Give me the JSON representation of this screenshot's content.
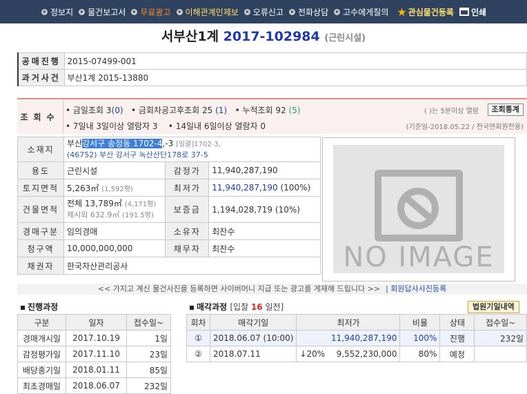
{
  "nav": {
    "items": [
      {
        "label": "정보지",
        "style": "normal"
      },
      {
        "label": "물건보고서",
        "style": "normal"
      },
      {
        "label": "무료광고",
        "style": "orange"
      },
      {
        "label": "이해관계인제보",
        "style": "yellow"
      },
      {
        "label": "오류신고",
        "style": "normal"
      },
      {
        "label": "전화상담",
        "style": "normal"
      },
      {
        "label": "고수에게질의",
        "style": "normal"
      }
    ],
    "favorite": "관심물건등록",
    "print": "인쇄"
  },
  "title": {
    "court": "서부산1계",
    "case_no": "2017-102984",
    "kind": "(근린시설)"
  },
  "public_sale": {
    "label": "공매진행",
    "value": "2015-07499-001"
  },
  "past_case": {
    "label": "과거사건",
    "value": "부산1계 2015-13880"
  },
  "views": {
    "label": "조회수",
    "today": "• 금일조회 3",
    "today_sub": "(0)",
    "after_notice": "• 금회차공고후조회 25",
    "after_notice_sub": "(1)",
    "total": "• 누적조회 92",
    "total_sub": "(5)",
    "week": "• 7일내 3일이상 열람자 3",
    "two_weeks": "• 14일내 6일이상 열람자 0",
    "note": "( )는 5분이상 열람",
    "button": "조회통계",
    "note2": "(기준일-2018.05.22 / 전국연회원전용)"
  },
  "details": {
    "location_label": "소재지",
    "location_pre": "부산",
    "location_sel": "강서구 송정동 1702-4",
    "location_post": ",-3",
    "location_bulk": "[일괄]1702-3,",
    "location_road": "(46752) 부산 강서구 녹산산단178로 37-5",
    "usage_label": "용도",
    "usage": "근린시설",
    "appraisal_label": "감정가",
    "appraisal": "11,940,287,190",
    "land_label": "토지면적",
    "land": "5,263㎡",
    "land_sub": "(1,592평)",
    "min_price_label": "최저가",
    "min_price": "11,940,287,190",
    "min_price_pct": "(100%)",
    "building_label": "건물면적",
    "building": "전체 13,789㎡",
    "building_sub": "(4,171평)",
    "building_excl": "제시외 632.9㎡",
    "building_excl_sub": "(191.5평)",
    "deposit_label": "보증금",
    "deposit": "1,194,028,719 (10%)",
    "auction_type_label": "경매구분",
    "auction_type": "임의경매",
    "owner_label": "소유자",
    "owner": "최찬수",
    "claim_label": "청구액",
    "claim": "10,000,000,000",
    "debtor_label": "채무자",
    "debtor": "최찬수",
    "creditor_label": "채권자",
    "creditor": "한국자산관리공사"
  },
  "image": {
    "placeholder": "NO IMAGE"
  },
  "notice": {
    "text": "<< 가지고 계신 물건사진을 등록하면 사이버머니 지급 또는 광고를 게재해 드립니다 >>",
    "link": "| 회원답사사진등록"
  },
  "progress": {
    "title": "진행과정",
    "headers": [
      "구분",
      "일자",
      "접수일~"
    ],
    "rows": [
      {
        "type": "경매개시일",
        "date": "2017.10.19",
        "days": "1일"
      },
      {
        "type": "감정평가일",
        "date": "2017.11.10",
        "days": "23일"
      },
      {
        "type": "배당종기일",
        "date": "2018.01.11",
        "days": "85일"
      },
      {
        "type": "최초경매일",
        "date": "2018.06.07",
        "days": "232일"
      }
    ]
  },
  "auction": {
    "title": "매각과정",
    "sub_pre": "[입찰 ",
    "sub_days": "16",
    "sub_post": " 일전]",
    "court_button": "법원기일내역",
    "headers": [
      "회차",
      "매각기일",
      "최저가",
      "비율",
      "상태",
      "접수일~"
    ],
    "rows": [
      {
        "round": "①",
        "date": "2018.06.07 (10:00)",
        "price": "11,940,287,190",
        "ratio": "100%",
        "status": "진행",
        "days": "232일"
      },
      {
        "round": "②",
        "date": "2018.07.11",
        "price_pre": "↓20%",
        "price": "9,552,230,000",
        "ratio": "80%",
        "status": "예정",
        "days": ""
      }
    ]
  }
}
